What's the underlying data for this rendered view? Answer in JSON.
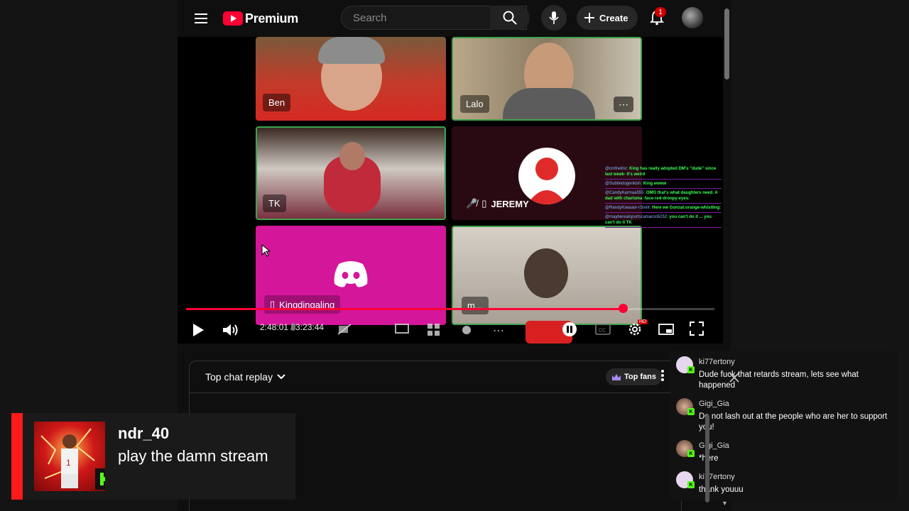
{
  "header": {
    "logo_text": "Premium",
    "search_placeholder": "Search",
    "create_label": "Create",
    "notification_count": "1"
  },
  "video": {
    "participants": [
      {
        "name": "Ben"
      },
      {
        "name": "Lalo"
      },
      {
        "name": "TK"
      },
      {
        "name": "JEREMY"
      },
      {
        "name": "Kingdingaling"
      },
      {
        "name": "m..."
      }
    ],
    "current_time": "2:48:01",
    "duration": "3:23:44",
    "time_display": "2:48:01 / 3:23:44",
    "progress_fraction": 0.826,
    "overlay_chat": [
      {
        "user": "@cmfredric",
        "text": "King has really adopted DM's \"dude\" since last week- it's weird"
      },
      {
        "user": "@Subtledogenkish",
        "text": "King ewww"
      },
      {
        "user": "@CandyKarmaa555",
        "text": "OMG that's what daughters need. A dad with charisma :face-red-droopy-eyes:"
      },
      {
        "user": "@RandyKiwaaor-rSmilr",
        "text": "Here we Gonzat:orange-whistling:"
      },
      {
        "user": "@mayberealsportscamaron5252",
        "text": "you can't do it ... you can't do it TK"
      }
    ]
  },
  "chat_panel": {
    "title": "Top chat replay",
    "top_fans_label": "Top fans"
  },
  "floating_chat": {
    "messages": [
      {
        "user": "ki77ertony",
        "text": "Dude fuck that retards stream, lets see what happened"
      },
      {
        "user": "Gigi_Gia",
        "text": "Do not lash out at the people who are her to support you!"
      },
      {
        "user": "Gigi_Gia",
        "text": "*here"
      },
      {
        "user": "ki77ertony",
        "text": "thank youuu"
      }
    ]
  },
  "highlight": {
    "user": "ndr_40",
    "text": "play the damn stream"
  },
  "colors": {
    "brand_red": "#ff0033",
    "kick_green": "#53fc18",
    "discord_pink": "#d4169b"
  }
}
